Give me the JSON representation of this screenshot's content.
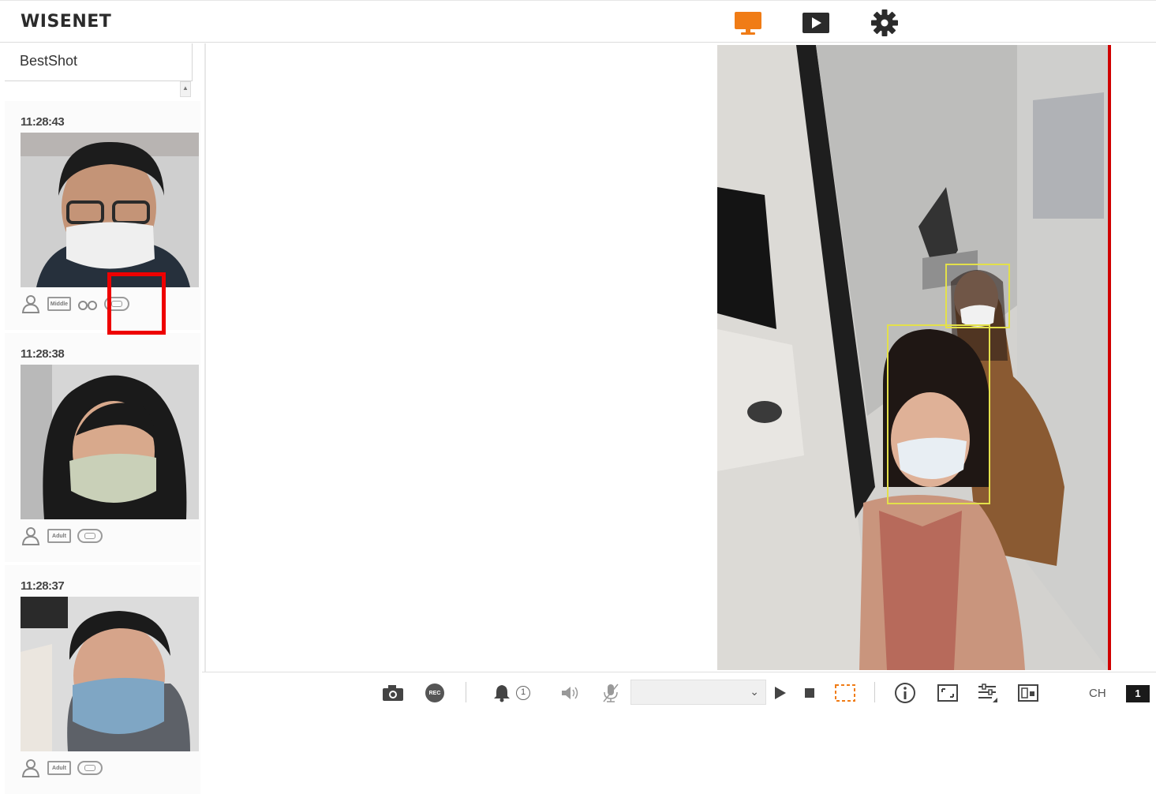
{
  "app": {
    "logo": "WISENET",
    "nav": [
      {
        "name": "live-view",
        "icon": "monitor-icon",
        "active": true
      },
      {
        "name": "playback",
        "icon": "play-icon",
        "active": false
      },
      {
        "name": "settings",
        "icon": "gear-icon",
        "active": false
      }
    ],
    "accent_color": "#f07c16"
  },
  "sidebar": {
    "title": "BestShot",
    "cards": [
      {
        "time": "11:28:43",
        "attributes": [
          "person-icon",
          "Middle",
          "glasses-icon",
          "mask-icon"
        ],
        "attr_labels": [
          "Middle"
        ]
      },
      {
        "time": "11:28:38",
        "attributes": [
          "person-icon",
          "Adult",
          "mask-icon"
        ],
        "attr_labels": [
          "Adult"
        ]
      },
      {
        "time": "11:28:37",
        "attributes": [
          "person-icon",
          "Adult",
          "mask-icon"
        ],
        "attr_labels": [
          "Adult"
        ]
      }
    ]
  },
  "toolbar": {
    "capture_icon": "camera-icon",
    "rec_label": "REC",
    "alarm_count": "1",
    "profile_value": "",
    "ch_label": "CH",
    "ch_value": "1"
  },
  "colors": {
    "highlight": "#ee0000",
    "detection_box": "#e3e04a",
    "roi": "#f07c16"
  }
}
